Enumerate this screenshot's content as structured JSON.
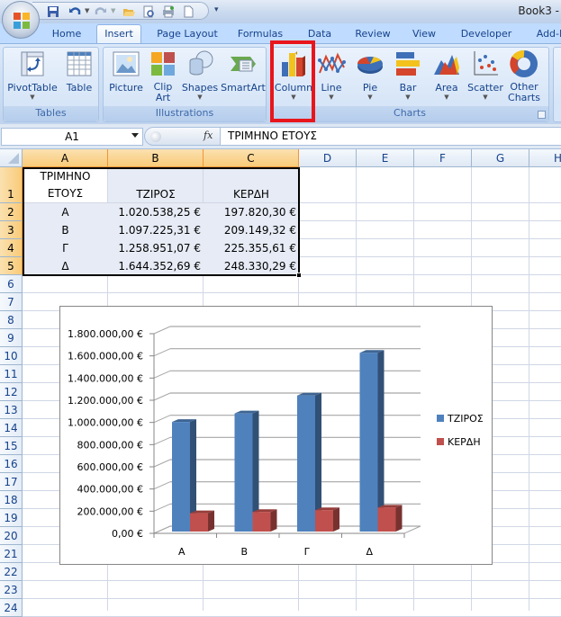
{
  "window": {
    "title": "Book3 -"
  },
  "quick_access": [
    "save-icon",
    "undo-icon",
    "redo-icon",
    "open-icon",
    "print-preview-icon",
    "quick-print-icon",
    "new-icon"
  ],
  "tabs": [
    {
      "label": "Home",
      "active": false
    },
    {
      "label": "Insert",
      "active": true
    },
    {
      "label": "Page Layout",
      "active": false
    },
    {
      "label": "Formulas",
      "active": false
    },
    {
      "label": "Data",
      "active": false
    },
    {
      "label": "Review",
      "active": false
    },
    {
      "label": "View",
      "active": false
    },
    {
      "label": "Developer",
      "active": false
    },
    {
      "label": "Add-I",
      "active": false
    }
  ],
  "ribbon": {
    "groups": [
      {
        "label": "Tables",
        "buttons": [
          {
            "label": "PivotTable",
            "dropdown": true,
            "icon": "pivottable-icon"
          },
          {
            "label": "Table",
            "icon": "table-icon"
          }
        ]
      },
      {
        "label": "Illustrations",
        "buttons": [
          {
            "label": "Picture",
            "icon": "picture-icon"
          },
          {
            "label": "Clip Art",
            "line1": "Clip",
            "line2": "Art",
            "icon": "clipart-icon"
          },
          {
            "label": "Shapes",
            "dropdown": true,
            "icon": "shapes-icon"
          },
          {
            "label": "SmartArt",
            "icon": "smartart-icon"
          }
        ]
      },
      {
        "label": "Charts",
        "buttons": [
          {
            "label": "Column",
            "dropdown": true,
            "icon": "column-chart-icon",
            "highlighted": true
          },
          {
            "label": "Line",
            "dropdown": true,
            "icon": "line-chart-icon"
          },
          {
            "label": "Pie",
            "dropdown": true,
            "icon": "pie-chart-icon"
          },
          {
            "label": "Bar",
            "dropdown": true,
            "icon": "bar-chart-icon"
          },
          {
            "label": "Area",
            "dropdown": true,
            "icon": "area-chart-icon"
          },
          {
            "label": "Scatter",
            "dropdown": true,
            "icon": "scatter-chart-icon"
          },
          {
            "label": "Other Charts",
            "line1": "Other",
            "line2": "Charts",
            "dropdown": true,
            "icon": "other-charts-icon"
          }
        ]
      }
    ],
    "highlight_color": "#e8161c"
  },
  "formula_bar": {
    "name_box": "A1",
    "fx_label": "fx",
    "formula": "ΤΡΙΜΗΝΟ ΕΤΟΥΣ"
  },
  "sheet": {
    "columns": [
      "A",
      "B",
      "C",
      "D",
      "E",
      "F",
      "G",
      "H"
    ],
    "selected_columns": [
      "A",
      "B",
      "C"
    ],
    "rows": [
      "1",
      "2",
      "3",
      "4",
      "5",
      "6",
      "7",
      "8",
      "9",
      "10",
      "11",
      "12",
      "13",
      "14",
      "15",
      "16",
      "17",
      "18",
      "19",
      "20",
      "21",
      "22",
      "23",
      "24"
    ],
    "selected_rows": [
      "1",
      "2",
      "3",
      "4",
      "5"
    ],
    "header": {
      "a_line1": "ΤΡΙΜΗΝΟ",
      "a_line2": "ΕΤΟΥΣ",
      "b": "ΤΖΙΡΟΣ",
      "c": "ΚΕΡΔΗ"
    },
    "data": [
      {
        "a": "Α",
        "b": "1.020.538,25 €",
        "c": "197.820,30 €"
      },
      {
        "a": "Β",
        "b": "1.097.225,31 €",
        "c": "209.149,32 €"
      },
      {
        "a": "Γ",
        "b": "1.258.951,07 €",
        "c": "225.355,61 €"
      },
      {
        "a": "Δ",
        "b": "1.644.352,69 €",
        "c": "248.330,29 €"
      }
    ]
  },
  "chart_data": {
    "type": "bar",
    "subtype": "3d-clustered-column",
    "title": "",
    "xlabel": "",
    "ylabel": "",
    "categories": [
      "Α",
      "Β",
      "Γ",
      "Δ"
    ],
    "series": [
      {
        "name": "ΤΖΙΡΟΣ",
        "color": "#4f81bd",
        "values": [
          1020538.25,
          1097225.31,
          1258951.07,
          1644352.69
        ]
      },
      {
        "name": "ΚΕΡΔΗ",
        "color": "#c0504d",
        "values": [
          197820.3,
          209149.32,
          225355.61,
          248330.29
        ]
      }
    ],
    "ylim": [
      0,
      1800000
    ],
    "yticks": [
      0,
      200000,
      400000,
      600000,
      800000,
      1000000,
      1200000,
      1400000,
      1600000,
      1800000
    ],
    "ytick_labels": [
      "0,00 €",
      "200.000,00 €",
      "400.000,00 €",
      "600.000,00 €",
      "800.000,00 €",
      "1.000.000,00 €",
      "1.200.000,00 €",
      "1.400.000,00 €",
      "1.600.000,00 €",
      "1.800.000,00 €"
    ],
    "grid": true,
    "legend": "right"
  }
}
